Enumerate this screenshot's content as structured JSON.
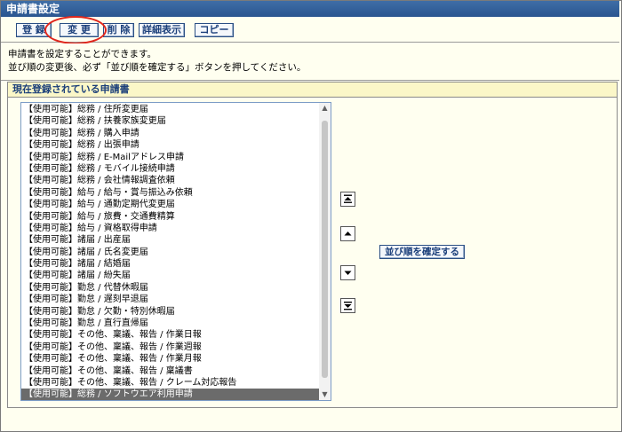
{
  "window": {
    "title": "申請書設定"
  },
  "toolbar": {
    "register_label": "登 録",
    "change_label": "変 更",
    "delete_label": "削 除",
    "detail_label": "詳細表示",
    "copy_label": "コピー"
  },
  "description": {
    "line1": "申請書を設定することができます。",
    "line2": "並び順の変更後、必ず「並び順を確定する」ボタンを押してください。"
  },
  "section": {
    "title": "現在登録されている申請書",
    "confirm_label": "並び順を確定する"
  },
  "forms": [
    "【使用可能】総務 / 住所変更届",
    "【使用可能】総務 / 扶養家族変更届",
    "【使用可能】総務 / 購入申請",
    "【使用可能】総務 / 出張申請",
    "【使用可能】総務 / E-Mailアドレス申請",
    "【使用可能】総務 / モバイル接続申請",
    "【使用可能】総務 / 会社情報調査依頼",
    "【使用可能】給与 / 給与・賞与振込み依頼",
    "【使用可能】給与 / 通勤定期代変更届",
    "【使用可能】給与 / 旅費・交通費精算",
    "【使用可能】給与 / 資格取得申請",
    "【使用可能】諸届 / 出産届",
    "【使用可能】諸届 / 氏名変更届",
    "【使用可能】諸届 / 結婚届",
    "【使用可能】諸届 / 紛失届",
    "【使用可能】勤怠 / 代替休暇届",
    "【使用可能】勤怠 / 遅刻早退届",
    "【使用可能】勤怠 / 欠勤・特別休暇届",
    "【使用可能】勤怠 / 直行直帰届",
    "【使用可能】その他、稟議、報告 / 作業日報",
    "【使用可能】その他、稟議、報告 / 作業週報",
    "【使用可能】その他、稟議、報告 / 作業月報",
    "【使用可能】その他、稟議、報告 / 稟議書",
    "【使用可能】その他、稟議、報告 / クレーム対応報告",
    "【使用可能】総務 / ソフトウエア利用申請"
  ],
  "selected_index": 24,
  "colors": {
    "accent_circle": "#e0261c",
    "title_bar": "#2a5590"
  }
}
